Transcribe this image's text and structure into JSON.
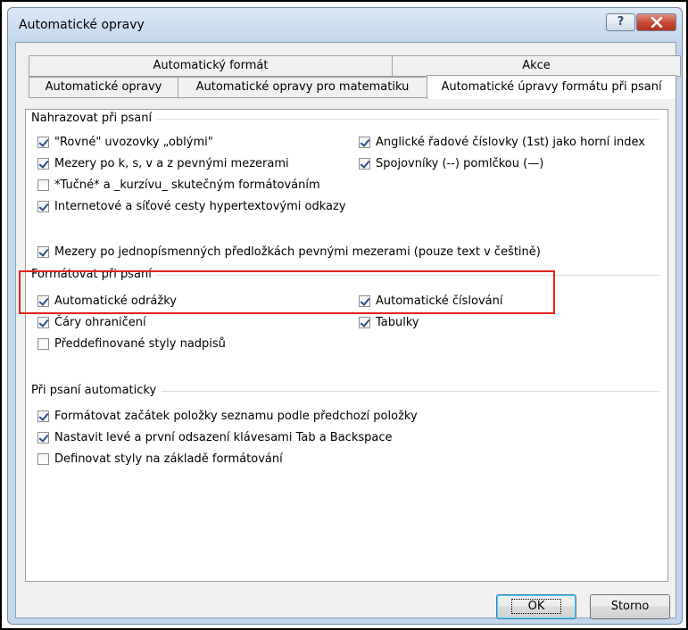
{
  "window": {
    "title": "Automatické opravy",
    "help_label": "?"
  },
  "tabs_row1": [
    {
      "label": "Automatický formát"
    },
    {
      "label": "Akce"
    }
  ],
  "tabs_row2": [
    {
      "label": "Automatické opravy"
    },
    {
      "label": "Automatické opravy pro matematiku"
    },
    {
      "label": "Automatické úpravy formátu při psaní",
      "active": true
    }
  ],
  "replace_group": {
    "title": "Nahrazovat při psaní",
    "items": [
      {
        "label": "\"Rovné\" uvozovky „oblými\"",
        "checked": true
      },
      {
        "label": "Anglické řadové číslovky (1st) jako horní index",
        "checked": true
      },
      {
        "label": "Mezery po k, s, v a z pevnými mezerami",
        "checked": true
      },
      {
        "label": "Spojovníky (--) pomlčkou (—)",
        "checked": true
      },
      {
        "label": "*Tučné* a _kurzívu_ skutečným formátováním",
        "checked": false
      },
      {
        "label": "Internetové a síťové cesty hypertextovými odkazy",
        "checked": true
      },
      {
        "label": "Mezery po jednopísmenných předložkách pevnými mezerami (pouze text v češtině)",
        "checked": true
      }
    ]
  },
  "format_group": {
    "title": "Formátovat při psaní",
    "items": [
      {
        "label": "Automatické odrážky",
        "checked": true
      },
      {
        "label": "Automatické číslování",
        "checked": true
      },
      {
        "label": "Čáry ohraničení",
        "checked": true
      },
      {
        "label": "Tabulky",
        "checked": true
      },
      {
        "label": "Předdefinované styly nadpisů",
        "checked": false
      }
    ]
  },
  "auto_group": {
    "title": "Při psaní automaticky",
    "items": [
      {
        "label": "Formátovat začátek položky seznamu podle předchozí položky",
        "checked": true
      },
      {
        "label": "Nastavit levé a první odsazení klávesami Tab a Backspace",
        "checked": true
      },
      {
        "label": "Definovat styly na základě formátování",
        "checked": false
      }
    ]
  },
  "buttons": {
    "ok": "OK",
    "cancel": "Storno"
  },
  "colors": {
    "highlight": "#e2231a",
    "frame": "#c3d6ec",
    "close": "#c64732"
  }
}
